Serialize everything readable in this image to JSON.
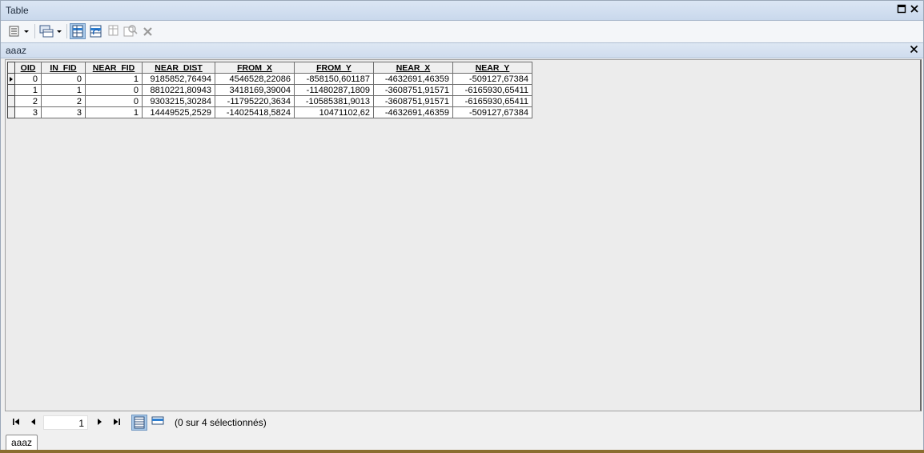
{
  "window": {
    "title": "Table"
  },
  "layer": {
    "name": "aaaz",
    "tab_label": "aaaz"
  },
  "table": {
    "columns": [
      "OID",
      "IN_FID",
      "NEAR_FID",
      "NEAR_DIST",
      "FROM_X",
      "FROM_Y",
      "NEAR_X",
      "NEAR_Y"
    ],
    "rows": [
      [
        "0",
        "0",
        "1",
        "9185852,76494",
        "4546528,22086",
        "-858150,601187",
        "-4632691,46359",
        "-509127,67384"
      ],
      [
        "1",
        "1",
        "0",
        "8810221,80943",
        "3418169,39004",
        "-11480287,1809",
        "-3608751,91571",
        "-6165930,65411"
      ],
      [
        "2",
        "2",
        "0",
        "9303215,30284",
        "-11795220,3634",
        "-10585381,9013",
        "-3608751,91571",
        "-6165930,65411"
      ],
      [
        "3",
        "3",
        "1",
        "14449525,2529",
        "-14025418,5824",
        "10471102,62",
        "-4632691,46359",
        "-509127,67384"
      ]
    ]
  },
  "navigation": {
    "current_record": "1",
    "status": "(0 sur 4 sélectionnés)"
  },
  "colors": {
    "titlebar": "#cfdcee",
    "highlight": "#a8c8e8",
    "close_gray": "#9a9a9a"
  }
}
